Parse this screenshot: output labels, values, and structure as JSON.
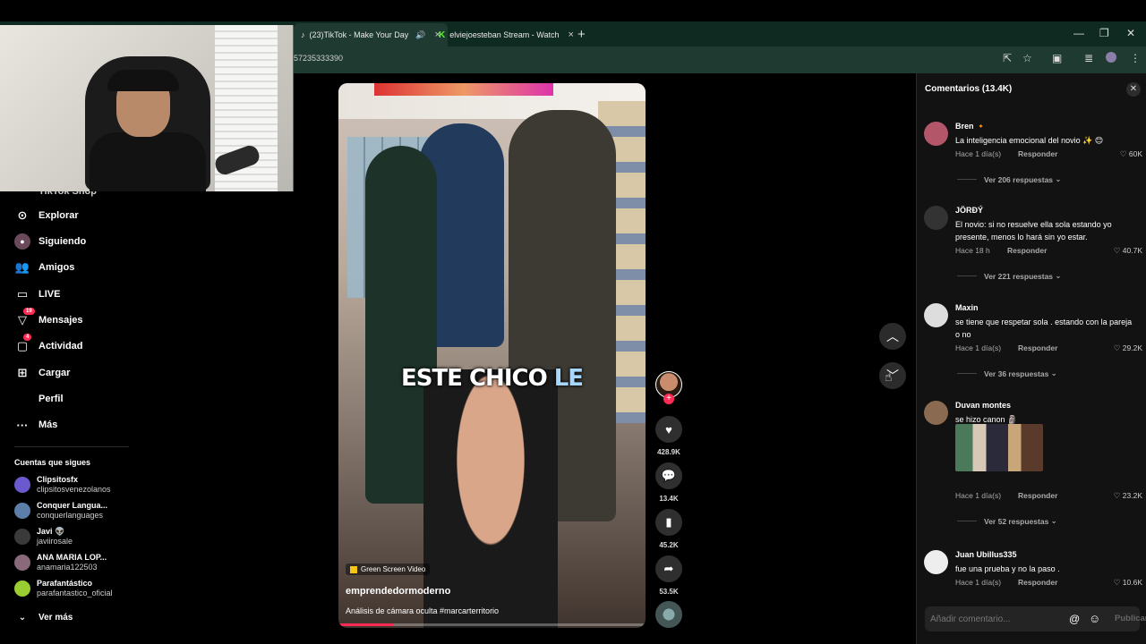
{
  "browser": {
    "tabs": [
      {
        "title": "(23)TikTok - Make Your Day",
        "close": "×"
      },
      {
        "title": "elviejoesteban Stream - Watch",
        "close": "×"
      }
    ],
    "new_tab": "+",
    "window_controls": [
      "—",
      "❐",
      "✕"
    ],
    "url": "57235333390"
  },
  "sidebar": {
    "shop_label": "TikTok Shop",
    "items": [
      {
        "label": "Explorar",
        "icon": "compass-icon"
      },
      {
        "label": "Siguiendo",
        "icon": "following-icon"
      },
      {
        "label": "Amigos",
        "icon": "friends-icon"
      },
      {
        "label": "LIVE",
        "icon": "live-icon"
      },
      {
        "label": "Mensajes",
        "icon": "messages-icon",
        "badge": "19"
      },
      {
        "label": "Actividad",
        "icon": "activity-icon",
        "badge": "4"
      },
      {
        "label": "Cargar",
        "icon": "upload-icon"
      },
      {
        "label": "Perfil",
        "icon": "profile-icon"
      },
      {
        "label": "Más",
        "icon": "more-icon"
      }
    ],
    "following_title": "Cuentas que sigues",
    "following": [
      {
        "name": "Clipsitosfx",
        "user": "clipsitosvenezolanos",
        "color": "#6a5acd"
      },
      {
        "name": "Conquer Langua...",
        "user": "conquerlanguages",
        "color": "#5b7fa8"
      },
      {
        "name": "Javi 👽",
        "user": "javiirosale",
        "color": "#3a3a3a"
      },
      {
        "name": "ANA MARIA LOP...",
        "user": "anamaria122503",
        "color": "#8a6a7a"
      },
      {
        "name": "Parafantástico",
        "user": "parafantastico_oficial",
        "color": "#9acd32"
      }
    ],
    "see_more": "Ver más"
  },
  "video": {
    "caption_main": "ESTE CHICO",
    "caption_highlight": "LE",
    "effect_tag": "Green Screen Video",
    "author": "emprendedormoderno",
    "description": "Análisis de cámara oculta #marcarterritorio",
    "progress": 0.18
  },
  "actions": {
    "likes": "428.9K",
    "comments": "13.4K",
    "saves": "45.2K",
    "shares": "53.5K"
  },
  "comments_panel": {
    "title": "Comentarios  (13.4K)",
    "comments": [
      {
        "user": "Bren 🔸",
        "text": "La inteligencia emocional del novio ✨ 😊",
        "time": "Hace 1 día(s)",
        "reply": "Responder",
        "likes": "60K",
        "more": "Ver 206 respuestas",
        "color": "#b4566a"
      },
      {
        "user": "JÖRÐÝ",
        "text": "El novio: si no resuelve ella sola estando yo presente, menos lo hará sin yo estar.",
        "time": "Hace 18 h",
        "reply": "Responder",
        "likes": "40.7K",
        "more": "Ver 221 respuestas",
        "color": "#333333"
      },
      {
        "user": "Maxin",
        "text": "se tiene que respetar sola . estando con la pareja o no",
        "time": "Hace 1 día(s)",
        "reply": "Responder",
        "likes": "29.2K",
        "more": "Ver 36 respuestas",
        "color": "#dddddd"
      },
      {
        "user": "Duvan montes",
        "text": "se hizo canon 🗿",
        "time": "Hace 1 día(s)",
        "reply": "Responder",
        "likes": "23.2K",
        "more": "Ver 52 respuestas",
        "color": "#8a6a50"
      },
      {
        "user": "Juan Ubillus335",
        "text": "fue una prueba y no la paso .",
        "time": "Hace 1 día(s)",
        "reply": "Responder",
        "likes": "10.6K",
        "color": "#eeeeee"
      }
    ],
    "input_placeholder": "Añadir comentario...",
    "post_label": "Publicar"
  },
  "colors": {
    "accent": "#fe2c55",
    "panel": "#121212",
    "chrome": "#1f3a30"
  }
}
